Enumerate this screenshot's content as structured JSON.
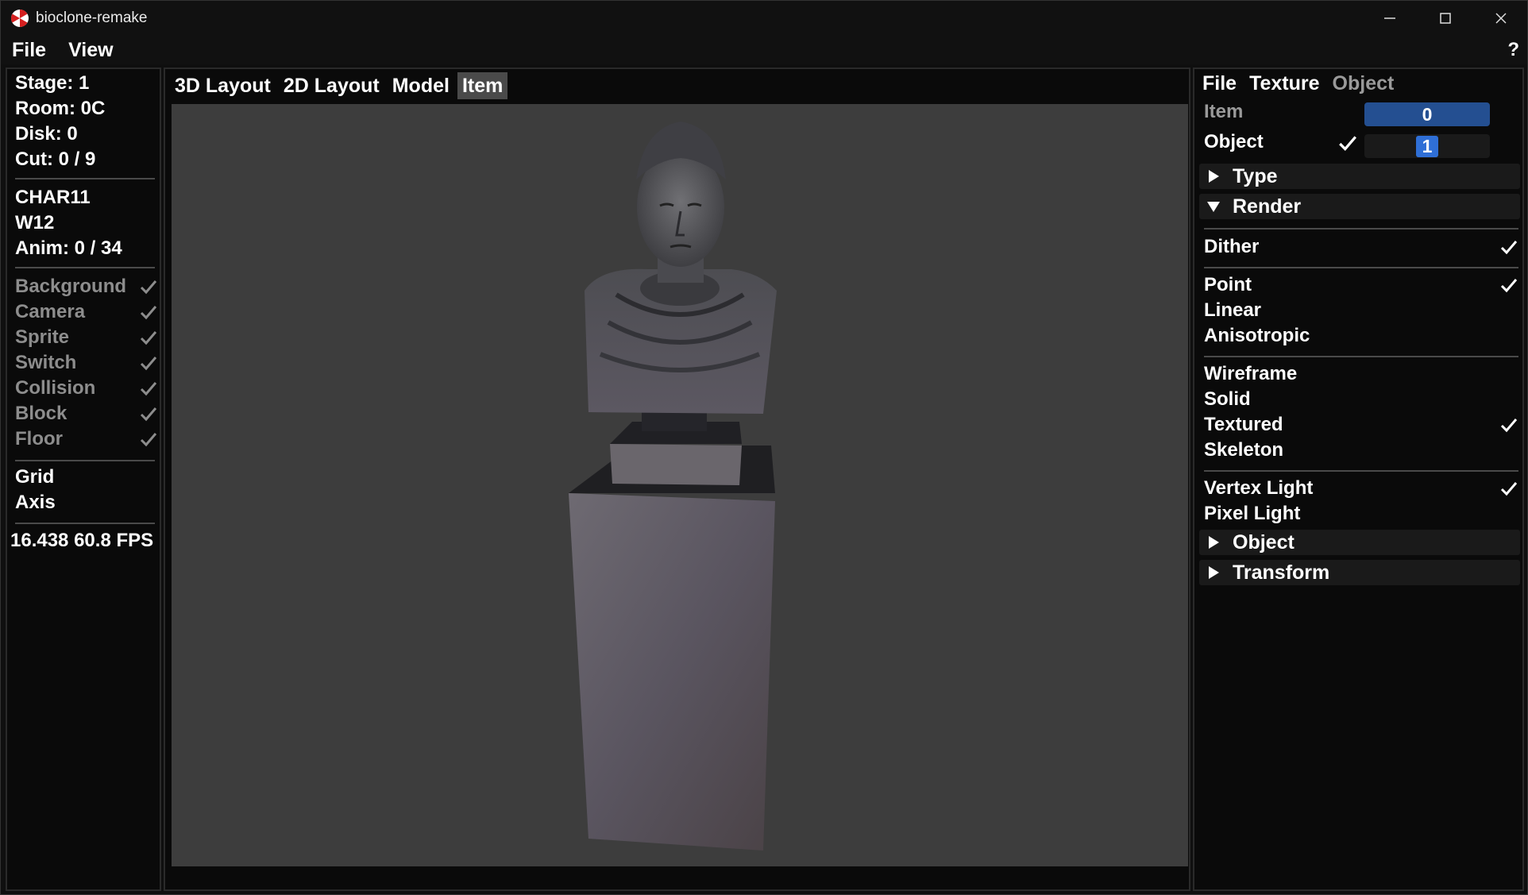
{
  "window": {
    "title": "bioclone-remake"
  },
  "menubar": {
    "items": [
      "File",
      "View"
    ],
    "help": "?"
  },
  "left_panel": {
    "info": [
      "Stage: 1",
      "Room: 0C",
      "Disk: 0",
      "Cut: 0 / 9"
    ],
    "model": [
      "CHAR11",
      "W12",
      "Anim: 0 / 34"
    ],
    "toggles": [
      {
        "label": "Background",
        "checked": true
      },
      {
        "label": "Camera",
        "checked": true
      },
      {
        "label": "Sprite",
        "checked": true
      },
      {
        "label": "Switch",
        "checked": true
      },
      {
        "label": "Collision",
        "checked": true
      },
      {
        "label": "Block",
        "checked": true
      },
      {
        "label": "Floor",
        "checked": true
      }
    ],
    "overlays": [
      "Grid",
      "Axis"
    ],
    "fps": "16.438 60.8 FPS"
  },
  "center": {
    "tabs": [
      "3D Layout",
      "2D Layout",
      "Model",
      "Item"
    ],
    "active_tab": "Item"
  },
  "right_panel": {
    "tabs": [
      "File",
      "Texture",
      "Object"
    ],
    "item_label": "Item",
    "item_value": "0",
    "object_label": "Object",
    "object_value": "1",
    "object_checked": true,
    "sections": {
      "type": "Type",
      "render": "Render",
      "object": "Object",
      "transform": "Transform"
    },
    "render": {
      "dither": {
        "label": "Dither",
        "checked": true
      },
      "filter": [
        {
          "label": "Point",
          "checked": true
        },
        {
          "label": "Linear",
          "checked": false
        },
        {
          "label": "Anisotropic",
          "checked": false
        }
      ],
      "mode": [
        {
          "label": "Wireframe",
          "checked": false
        },
        {
          "label": "Solid",
          "checked": false
        },
        {
          "label": "Textured",
          "checked": true
        },
        {
          "label": "Skeleton",
          "checked": false
        }
      ],
      "light": [
        {
          "label": "Vertex Light",
          "checked": true
        },
        {
          "label": "Pixel Light",
          "checked": false
        }
      ]
    }
  },
  "colors": {
    "accent": "#2f6fd6",
    "accent_dim": "#244f91",
    "viewport_bg": "#3d3d3d",
    "disabled_text": "#8d8d8d"
  }
}
